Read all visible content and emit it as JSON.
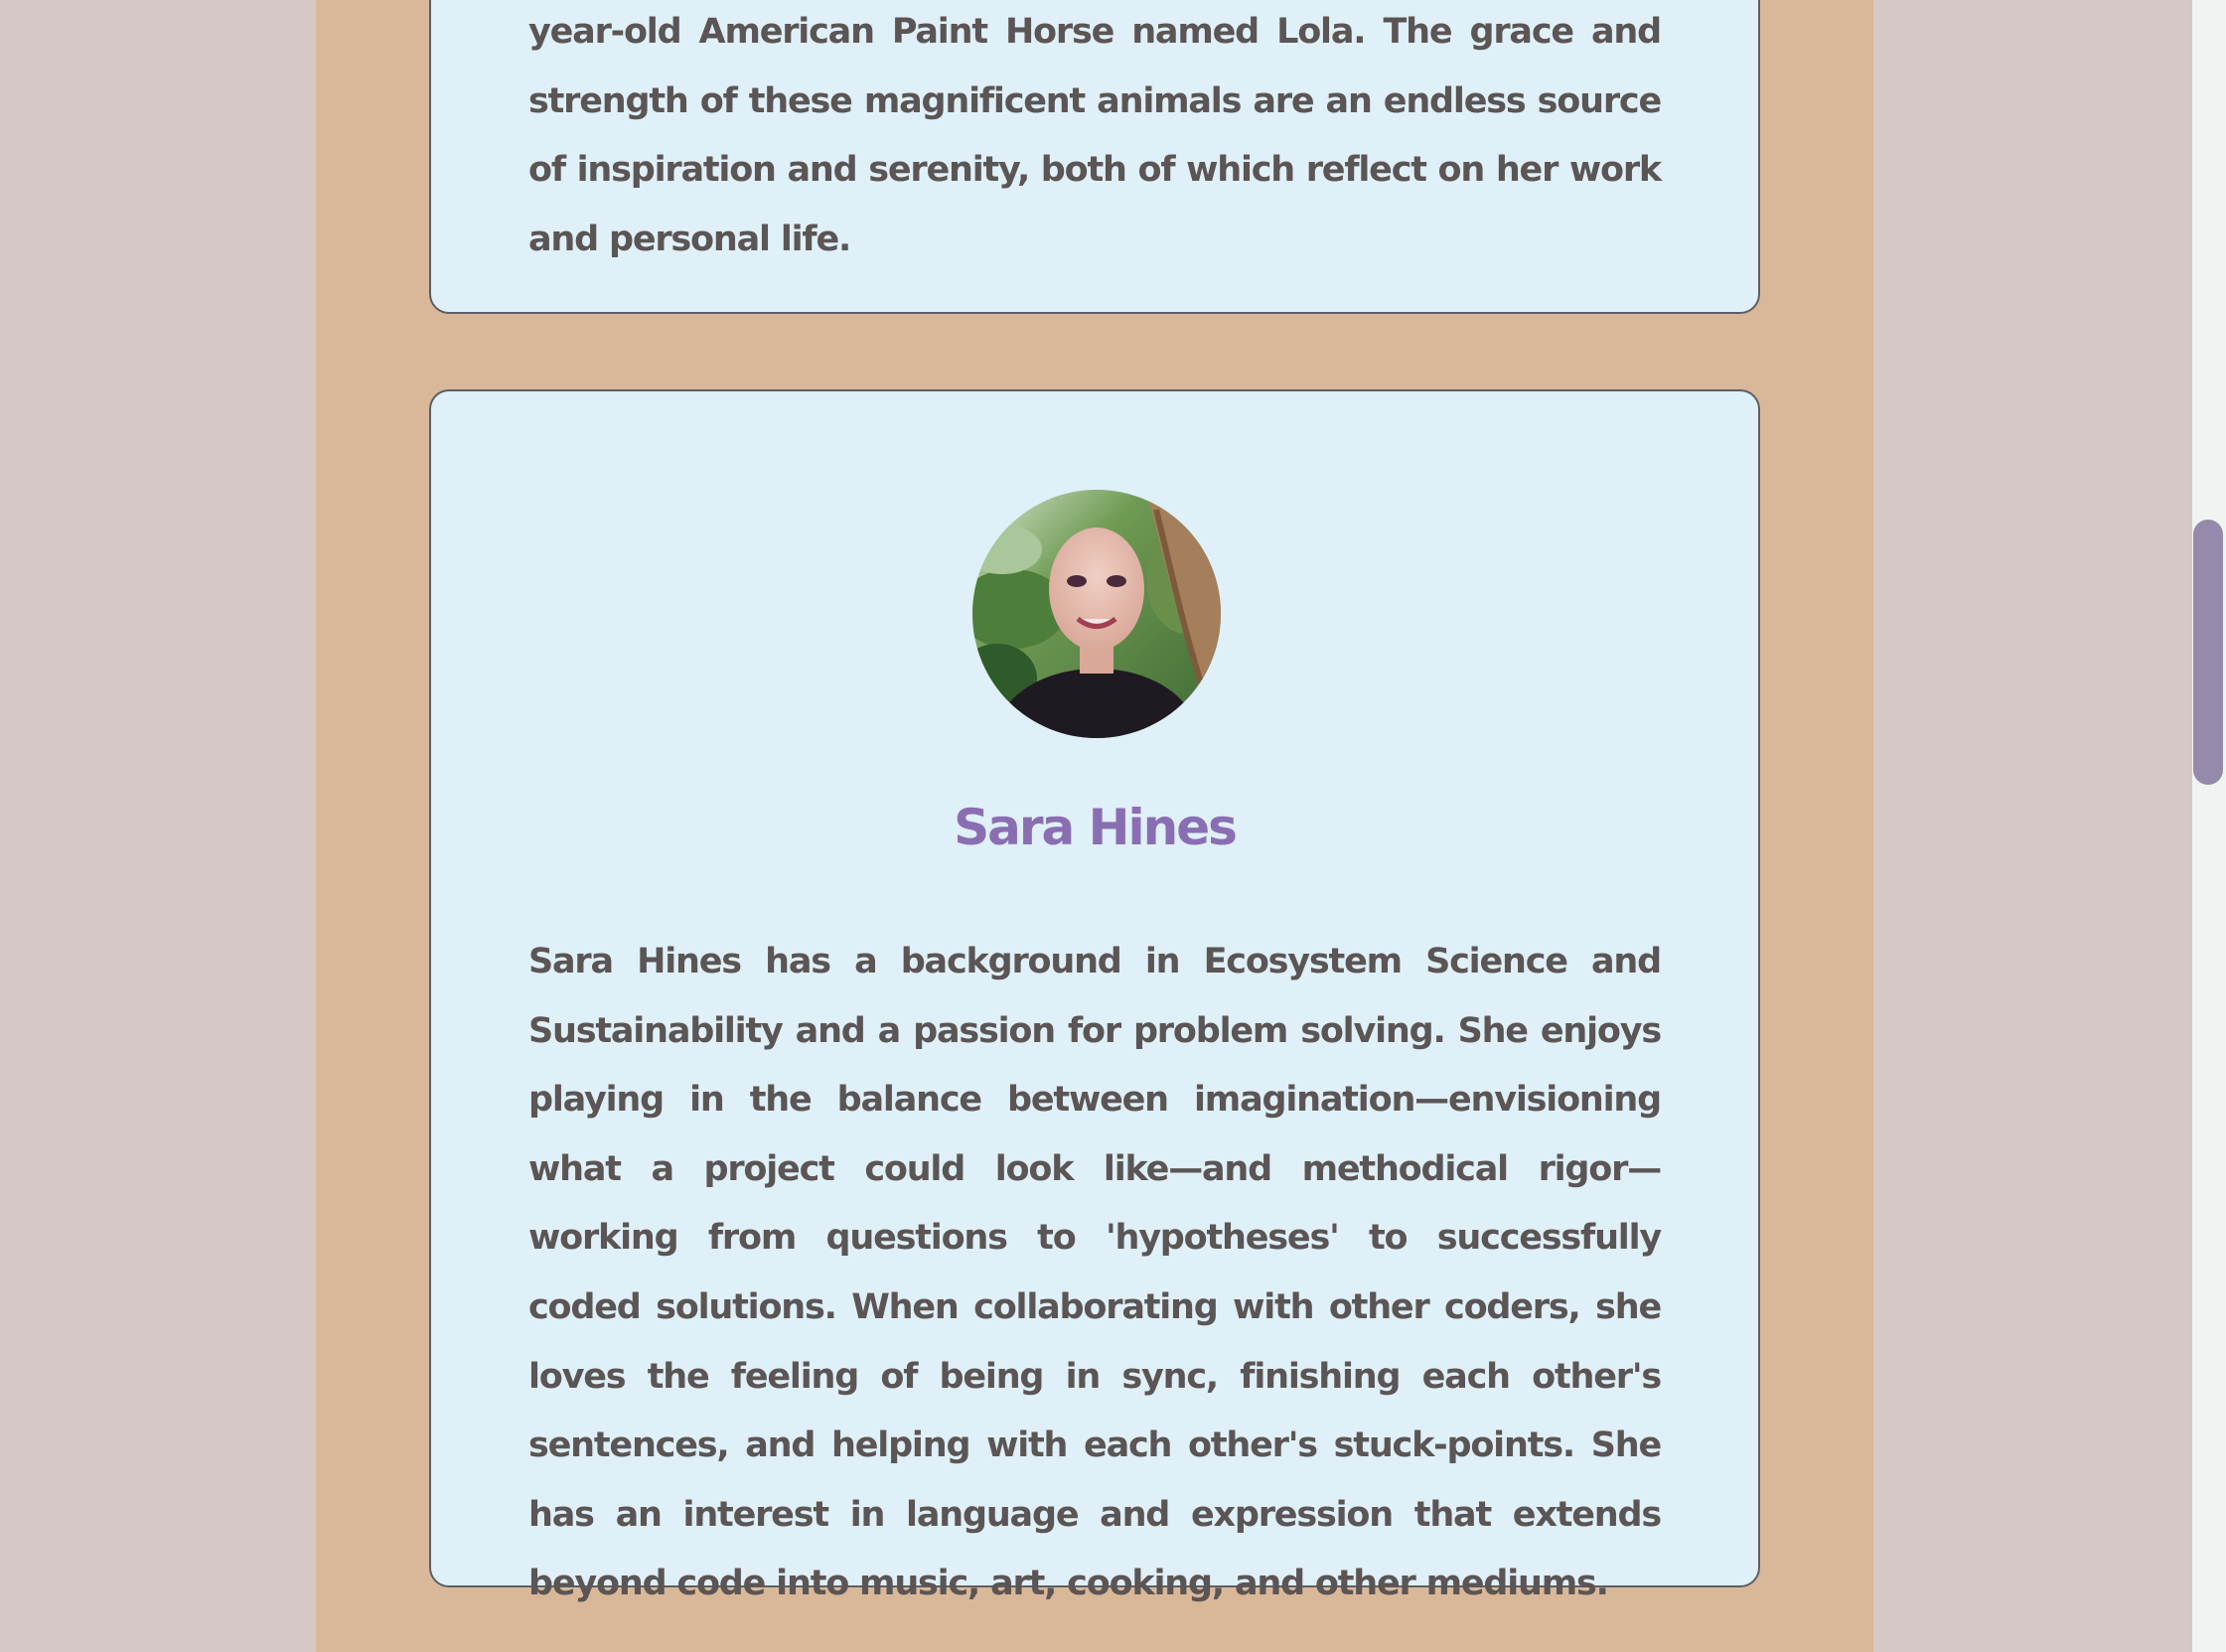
{
  "profiles": [
    {
      "bio": "year-old American Paint Horse named Lola. The grace and strength of these magnificent animals are an endless source of inspiration and serenity, both of which reflect on her work and personal life."
    },
    {
      "name": "Sara Hines",
      "bio": "Sara Hines has a background in Ecosystem Science and Sustainability and a passion for problem solving. She enjoys playing in the balance between imagination—envisioning what a project could look like—and methodical rigor—working from questions to 'hypotheses' to successfully coded solutions. When collaborating with other coders, she loves the feeling of being in sync, finishing each other's sentences, and helping with each other's stuck-points. She has an interest in language and expression that extends beyond code into music, art, cooking, and other mediums."
    }
  ],
  "colors": {
    "page_bg": "#d5c8c7",
    "column_bg": "#d9b899",
    "card_bg": "#dff0f8",
    "name_color": "#8a6eb2",
    "text_color": "#5b5555",
    "scrollbar_thumb": "#958aab"
  }
}
